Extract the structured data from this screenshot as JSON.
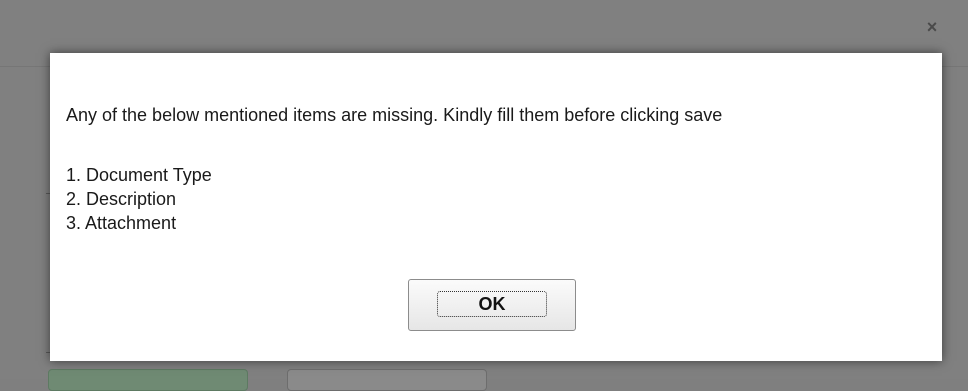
{
  "background": {
    "close_glyph": "×",
    "dim_color": "#808080"
  },
  "dialog": {
    "message": "Any of the below mentioned items are missing. Kindly fill them before clicking save",
    "missing_items": [
      "1. Document Type",
      "2. Description",
      "3. Attachment"
    ],
    "ok_label": "OK"
  }
}
